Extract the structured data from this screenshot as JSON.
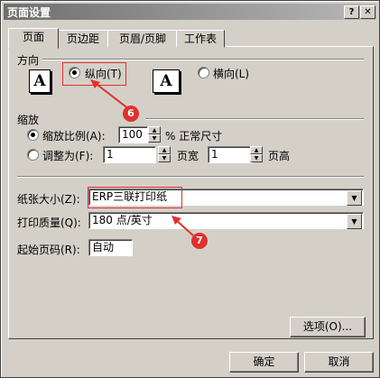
{
  "window": {
    "title": "页面设置",
    "help_btn": "?",
    "close_btn": "✕"
  },
  "tabs": [
    "页面",
    "页边距",
    "页眉/页脚",
    "工作表"
  ],
  "orientation": {
    "section": "方向",
    "portrait": "纵向(T)",
    "landscape": "横向(L)",
    "icon_glyph": "A"
  },
  "scaling": {
    "section": "缩放",
    "adjust_to_label": "缩放比例(A):",
    "adjust_to_value": "100",
    "adjust_to_suffix": "% 正常尺寸",
    "fit_to_label": "调整为(F):",
    "pages_wide_value": "1",
    "pages_wide_label": "页宽",
    "pages_tall_value": "1",
    "pages_tall_label": "页高"
  },
  "paper": {
    "size_label": "纸张大小(Z):",
    "size_value": "ERP三联打印纸",
    "quality_label": "打印质量(Q):",
    "quality_value": "180 点/英寸",
    "first_page_label": "起始页码(R):",
    "first_page_value": "自动"
  },
  "buttons": {
    "options": "选项(O)...",
    "ok": "确定",
    "cancel": "取消"
  },
  "annotations": {
    "badge_6": "6",
    "badge_7": "7"
  },
  "colors": {
    "annotation": "#e03030",
    "titlebar": "#808080"
  }
}
